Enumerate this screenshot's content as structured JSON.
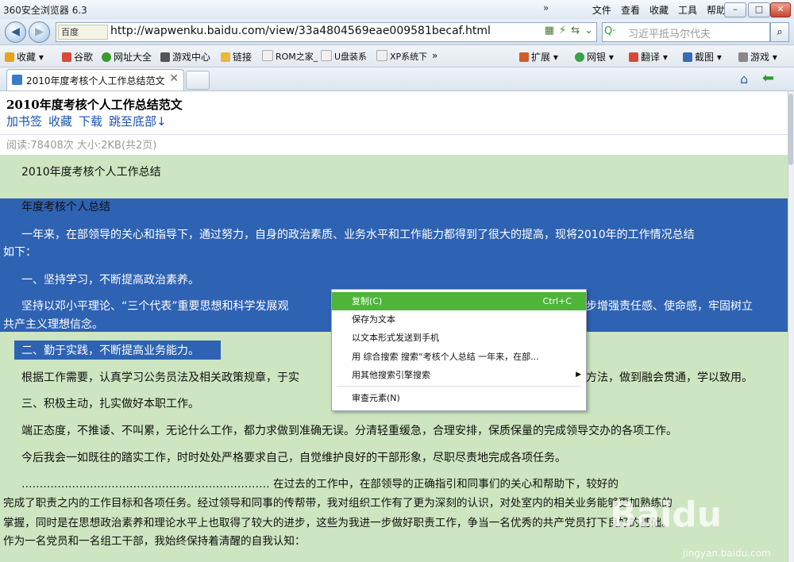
{
  "window": {
    "title": "360安全浏览器 6.3",
    "chevron": "»",
    "min": "–",
    "max": "□",
    "close": "✕"
  },
  "menu": [
    "文件",
    "查看",
    "收藏",
    "工具",
    "帮助"
  ],
  "nav": {
    "back": "◀",
    "forward": "▶",
    "engine": "百度",
    "url": "http://wapwenku.baidu.com/view/33a4804569eae009581becaf.html",
    "icons": [
      "▦",
      "⚡",
      "⇆",
      "⌄"
    ],
    "search_placeholder": "习近平抵马尔代夫",
    "search_logo": "Q·",
    "search_btn": "⌕"
  },
  "bookmarks": [
    {
      "label": "收藏",
      "color": "#e8a21b"
    },
    {
      "label": "谷歌",
      "color": "#d94a3c"
    },
    {
      "label": "网址大全",
      "color": "#3a9a2a"
    },
    {
      "label": "游戏中心",
      "color": "#555555"
    },
    {
      "label": "链接",
      "color": "#e7b93c"
    },
    {
      "label": "ROM之家_",
      "color": "#f0f0f0"
    },
    {
      "label": "U盘装系",
      "color": "#f0f0f0"
    },
    {
      "label": "XP系统下",
      "color": "#f0f0f0"
    },
    {
      "label": "»",
      "color": ""
    },
    {
      "label": "扩展",
      "color": "#d45a2a"
    },
    {
      "label": "网银",
      "color": "#3aa04a"
    },
    {
      "label": "翻译",
      "color": "#d44a3a"
    },
    {
      "label": "截图",
      "color": "#3a6ab0"
    },
    {
      "label": "游戏",
      "color": "#888888"
    }
  ],
  "tab": {
    "label": "2010年度考核个人工作总结范文",
    "close": "✕"
  },
  "toolbar_icons": {
    "home": "⌂",
    "back": "⬅"
  },
  "doc": {
    "title": "2010年度考核个人工作总结范文",
    "links": [
      "加书签",
      "收藏",
      "下载",
      "跳至底部↓"
    ],
    "meta": "阅读:78408次 大小:2KB(共2页)",
    "p1": "2010年度考核个人工作总结",
    "p2": "年度考核个人总结",
    "p3a": "一年来，在部领导的关心和指导下，通过努力，自身的政治素质、业务水平和工作能力都得到了很大的提高，现将2010年的工作情况总结",
    "p3b": "如下：",
    "p4": "一、坚持学习，不断提高政治素养。",
    "p5a": "坚持以邓小平理论、“三个代表”重要思想和科学发展观",
    "p5b": "步增强责任感、使命感，牢固树立",
    "p5c": "共产主义理想信念。",
    "p6": "二、勤于实践，不断提高业务能力。",
    "p7a": "根据工作需要，认真学习公务员法及相关政策规章，于实",
    "p7b": "方法，做到融会贯通，学以致用。",
    "p8": "三、积极主动，扎实做好本职工作。",
    "p9": "端正态度，不推诿、不叫累，无论什么工作，都力求做到准确无误。分清轻重缓急，合理安排，保质保量的完成领导交办的各项工作。",
    "p10": "今后我会一如既往的踏实工作，时时处处严格要求自己，自觉维护良好的干部形象，尽职尽责地完成各项任务。",
    "p11a": "…………………………………………………………… 在过去的工作中，在部领导的正确指引和同事们的关心和帮助下，较好的",
    "p11b": "完成了职责之内的工作目标和各项任务。经过领导和同事的传帮带，我对组织工作有了更为深刻的认识，对处室内的相关业务能够更加熟练的",
    "p11c": "掌握，同时是在思想政治素养和理论水平上也取得了较大的进步，这些为我进一步做好职责工作，争当一名优秀的共产党员打下良好的基础。",
    "p11d": "作为一名党员和一名组工干部，我始终保持着清醒的自我认知："
  },
  "context_menu": {
    "copy": "复制(C)",
    "copy_key": "Ctrl+C",
    "save": "保存为文本",
    "send": "以文本形式发送到手机",
    "search": "用 综合搜索 搜索“考核个人总结 一年来，在部...",
    "other": "用其他搜索引擎搜索",
    "other_arrow": "▶",
    "inspect": "审查元素(N)"
  },
  "watermark": {
    "main": "Baidu",
    "sub": "jingyan.baidu.com"
  }
}
